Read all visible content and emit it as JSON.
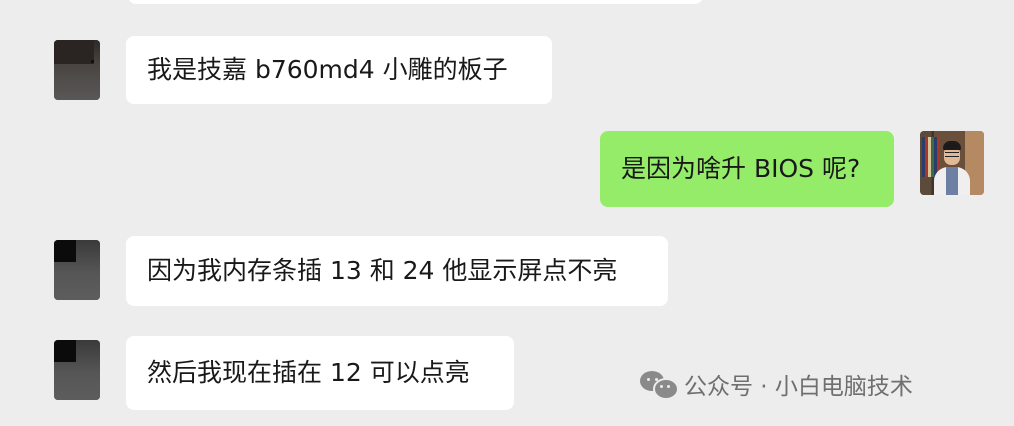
{
  "messages": [
    {
      "side": "left",
      "text": "我是技嘉 b760md4 小雕的板子"
    },
    {
      "side": "right",
      "text": "是因为啥升 BIOS 呢?"
    },
    {
      "side": "left",
      "text": "因为我内存条插 13 和 24 他显示屏点不亮"
    },
    {
      "side": "left",
      "text": "然后我现在插在 12 可以点亮"
    }
  ],
  "watermark": {
    "icon": "wechat-icon",
    "text": "公众号 · 小白电脑技术"
  },
  "colors": {
    "background": "#ededed",
    "incoming_bubble": "#ffffff",
    "outgoing_bubble": "#95ec69",
    "text": "#191919",
    "watermark": "#6f6f6f"
  }
}
